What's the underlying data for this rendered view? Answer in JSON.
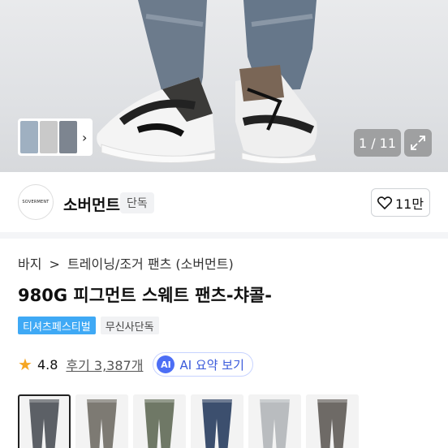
{
  "gallery": {
    "counter": "1 / 11",
    "thumb_more_icon": "chevron-right-icon",
    "expand_icon": "expand-icon"
  },
  "brand": {
    "logo_text": "SOVERMENT",
    "name": "소버먼트",
    "badge": "단독",
    "likes": "11만"
  },
  "breadcrumb": {
    "category": "바지",
    "separator": ">",
    "subcategory": "트레이닝/조거 팬츠 (소버먼트)"
  },
  "product": {
    "title": "980G 피그먼트 스웨트 팬츠-챠콜-",
    "tags": [
      "티셔츠페스티벌",
      "무신사단독"
    ]
  },
  "rating": {
    "score": "4.8",
    "reviews": "후기 3,387개",
    "ai_badge": "AI",
    "ai_label": "AI 요약 보기"
  },
  "colors": {
    "accent_blue": "#3fa9f5",
    "star": "#f5a623",
    "ai": "#4c6ef5"
  },
  "swatches": [
    {
      "name": "charcoal",
      "color": "#5c6066"
    },
    {
      "name": "gray-brown",
      "color": "#7d7a73"
    },
    {
      "name": "khaki",
      "color": "#6f7866"
    },
    {
      "name": "navy",
      "color": "#3c4f6e"
    },
    {
      "name": "light-gray",
      "color": "#b9bcbf"
    },
    {
      "name": "brown-gray",
      "color": "#6e6a66"
    }
  ]
}
